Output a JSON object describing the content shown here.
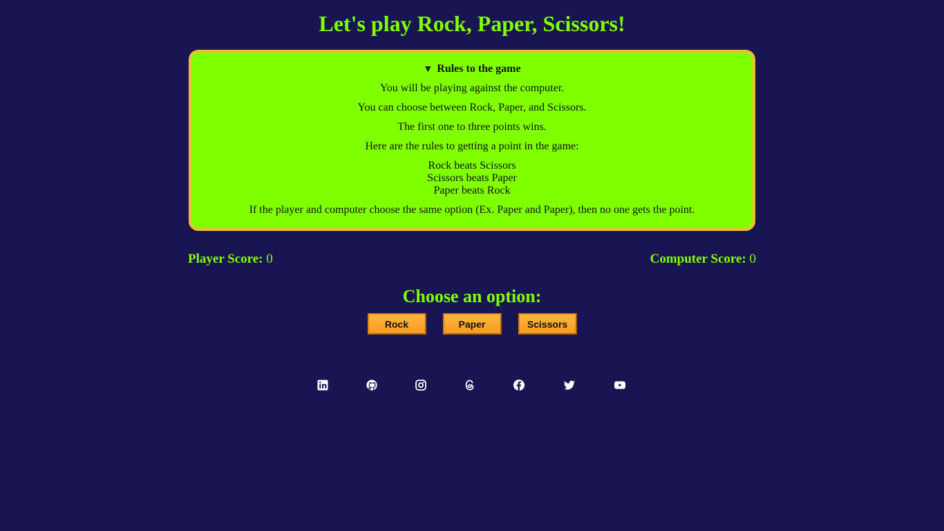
{
  "page": {
    "title": "Let's play Rock, Paper, Scissors!"
  },
  "rules": {
    "summary": "Rules to the game",
    "toggle_glyph": "▼",
    "lines": [
      "You will be playing against the computer.",
      "You can choose between Rock, Paper, and Scissors.",
      "The first one to three points wins.",
      "Here are the rules to getting a point in the game:",
      "Rock beats Scissors",
      "Scissors beats Paper",
      "Paper beats Rock",
      "If the player and computer choose the same option (Ex. Paper and Paper), then no one gets the point."
    ]
  },
  "scores": {
    "player_label": "Player Score:",
    "player_value": "0",
    "computer_label": "Computer Score:",
    "computer_value": "0"
  },
  "choose": {
    "title": "Choose an option:",
    "options": [
      "Rock",
      "Paper",
      "Scissors"
    ]
  },
  "socials": [
    "linkedin-icon",
    "github-icon",
    "instagram-icon",
    "threads-icon",
    "facebook-icon",
    "twitter-icon",
    "youtube-icon"
  ],
  "colors": {
    "background": "#181552",
    "accent_green": "#7fff00",
    "rules_border": "#f2bd36",
    "button_orange": "#f89c22"
  }
}
